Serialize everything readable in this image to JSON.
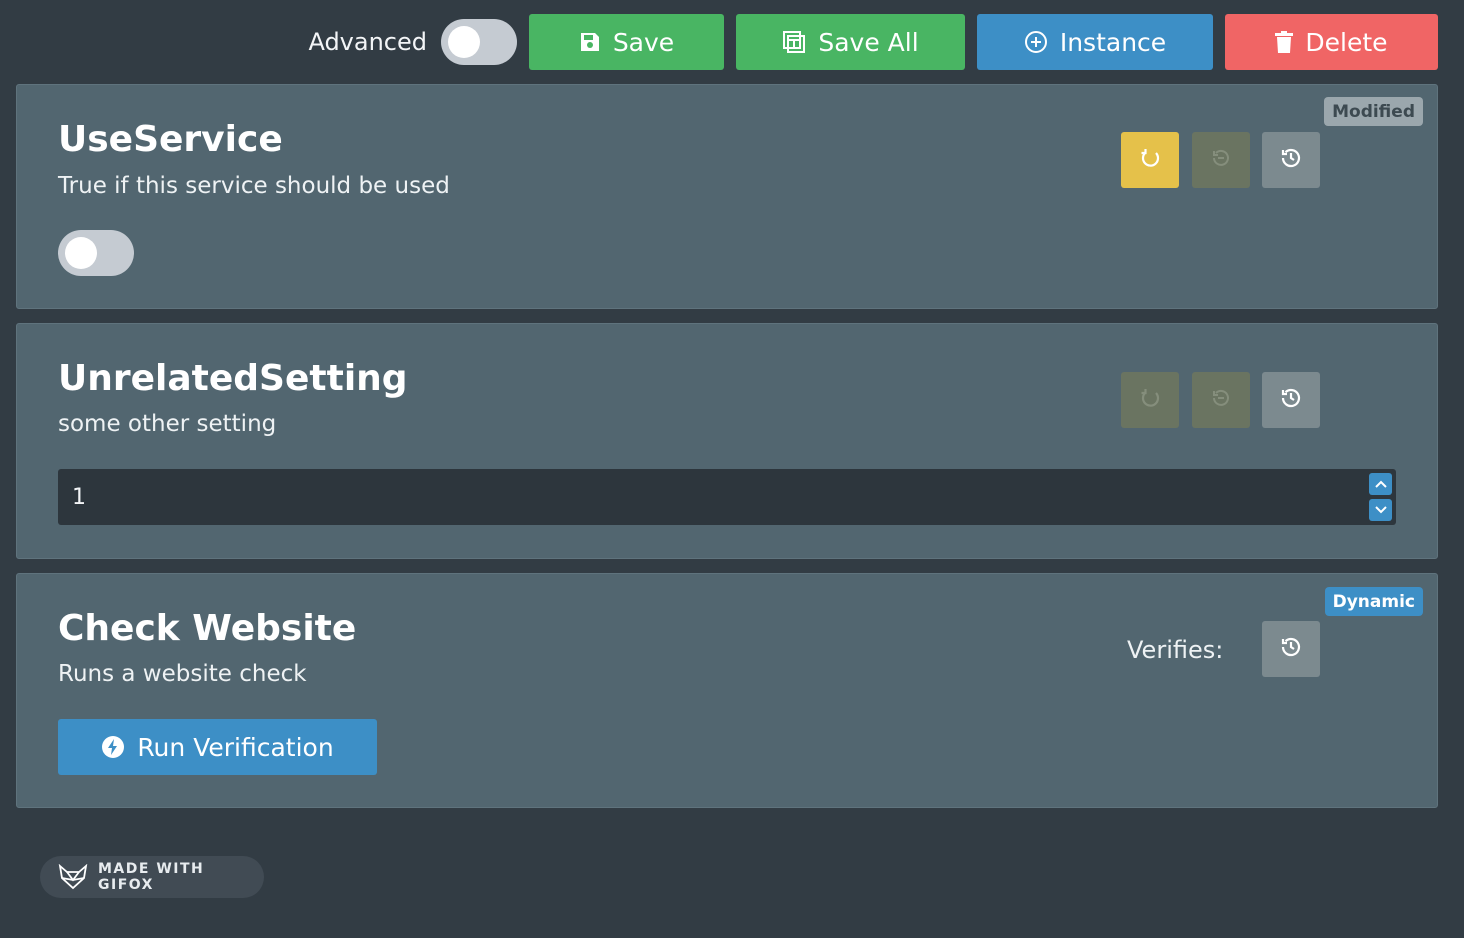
{
  "toolbar": {
    "advanced_label": "Advanced",
    "save_label": "Save",
    "save_all_label": "Save All",
    "instance_label": "Instance",
    "delete_label": "Delete"
  },
  "settings": [
    {
      "title": "UseService",
      "description": "True if this service should be used",
      "badge": "Modified",
      "control": "toggle",
      "toggle_on": false
    },
    {
      "title": "UnrelatedSetting",
      "description": "some other setting",
      "control": "number",
      "value": "1"
    },
    {
      "title": "Check Website",
      "description": "Runs a website check",
      "badge": "Dynamic",
      "verifies_label": "Verifies:",
      "run_label": "Run Verification"
    }
  ],
  "footer": {
    "made_with": "MADE WITH GIFOX"
  },
  "colors": {
    "background": "#323c44",
    "card": "#526670",
    "green": "#49b563",
    "blue": "#3d8fc6",
    "red": "#f06565",
    "yellow": "#e5c14a"
  },
  "icons": [
    "save-icon",
    "save-all-icon",
    "plus-circle-icon",
    "trash-icon",
    "refresh-icon",
    "undo-icon",
    "history-icon",
    "bolt-icon",
    "chevron-up-icon",
    "chevron-down-icon",
    "fox-logo-icon"
  ]
}
